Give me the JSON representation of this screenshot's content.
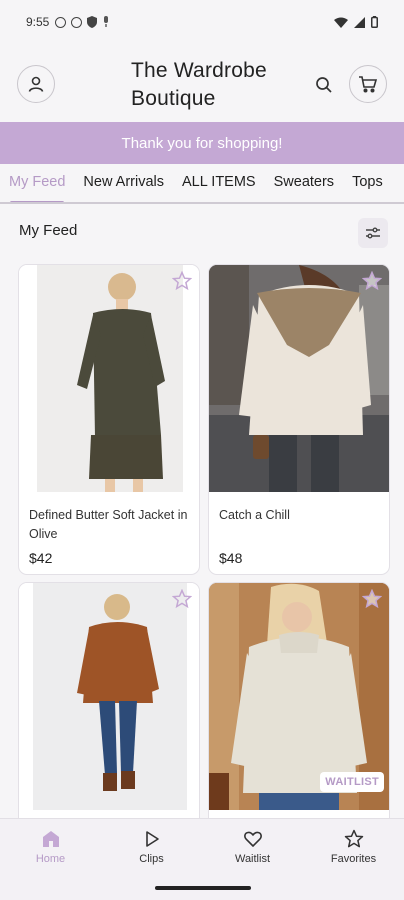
{
  "status": {
    "time": "9:55"
  },
  "header": {
    "brand": "The Wardrobe Boutique"
  },
  "banner": {
    "text": "Thank you for shopping!"
  },
  "tabs": [
    {
      "label": "My Feed",
      "active": true
    },
    {
      "label": "New Arrivals"
    },
    {
      "label": "ALL ITEMS"
    },
    {
      "label": "Sweaters"
    },
    {
      "label": "Tops"
    }
  ],
  "feed": {
    "title": "My Feed"
  },
  "products": [
    {
      "name": "Defined Butter Soft Jacket in Olive",
      "price": "$42"
    },
    {
      "name": "Catch a Chill",
      "price": "$48"
    },
    {
      "name": "",
      "price": ""
    },
    {
      "name": "",
      "price": "",
      "badge": "WAITLIST"
    }
  ],
  "nav": [
    {
      "label": "Home",
      "icon": "home-icon",
      "active": true
    },
    {
      "label": "Clips",
      "icon": "play-icon"
    },
    {
      "label": "Waitlist",
      "icon": "heart-icon"
    },
    {
      "label": "Favorites",
      "icon": "star-icon"
    }
  ],
  "colors": {
    "accent": "#b59ac6",
    "banner": "#c4a8d4"
  }
}
